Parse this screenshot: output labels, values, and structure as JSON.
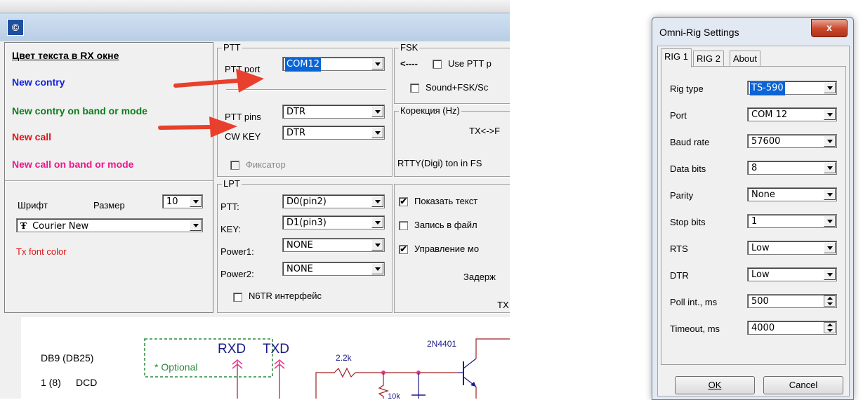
{
  "left_window": {
    "icon_glyph": "©",
    "colors_section": {
      "heading": "Цвет текста в RX окне",
      "items": [
        {
          "label": "New contry",
          "color": "#1020e0"
        },
        {
          "label": "New contry on band or mode",
          "color": "#0a7d1a"
        },
        {
          "label": "New call",
          "color": "#e01414"
        },
        {
          "label": "New call on band or mode",
          "color": "#f0148c"
        }
      ],
      "font_label": "Шрифт",
      "size_label": "Размер",
      "size_value": "10",
      "font_value": "Courier New",
      "tx_font_color": "Tx font color",
      "tx_font_color_hex": "#e01414"
    },
    "ptt": {
      "title": "PTT",
      "port_label": "PTT port",
      "port_value": "COM12",
      "pins_label": "PTT pins",
      "pins_value": "DTR",
      "cwkey_label": "CW KEY",
      "cwkey_value": "DTR",
      "latch_label": "Фиксатор"
    },
    "fsk": {
      "title": "FSK",
      "arrow": "<----",
      "use_ptt_label": "Use PTT p",
      "sound_fsk_label": "Sound+FSK/Sc"
    },
    "correction": {
      "title": "Корекция (Hz)",
      "txrx": "TX<->F",
      "rtty": "RTTY(Digi) ton in FS"
    },
    "lpt": {
      "title": "LPT",
      "rows": [
        {
          "label": "PTT:",
          "value": "D0(pin2)"
        },
        {
          "label": "KEY:",
          "value": "D1(pin3)"
        },
        {
          "label": "Power1:",
          "value": "NONE"
        },
        {
          "label": "Power2:",
          "value": "NONE"
        }
      ],
      "n6tr_label": "N6TR интерфейс"
    },
    "options": {
      "show_text": "Показать текст",
      "write_file": "Запись в файл",
      "control": "Управление мо",
      "delay": "Задерж",
      "tx": "TX"
    },
    "schematic": {
      "db9": "DB9 (DB25)",
      "optional": "* Optional",
      "rxd": "RXD",
      "txd": "TXD",
      "resistor": "2.2k",
      "transistor": "2N4401",
      "pin_num": "1 (8)",
      "pin_name": "DCD",
      "resistor2": "10k"
    },
    "arrow_color": "#e8402c"
  },
  "omni_rig": {
    "title": "Omni-Rig Settings",
    "close_glyph": "x",
    "tabs": [
      "RIG 1",
      "RIG 2",
      "About"
    ],
    "rows": [
      {
        "label": "Rig type",
        "value": "TS-590",
        "selected": true,
        "ctrl": "combo"
      },
      {
        "label": "Port",
        "value": "COM 12",
        "ctrl": "combo"
      },
      {
        "label": "Baud rate",
        "value": "57600",
        "ctrl": "combo"
      },
      {
        "label": "Data bits",
        "value": "8",
        "ctrl": "combo"
      },
      {
        "label": "Parity",
        "value": "None",
        "ctrl": "combo"
      },
      {
        "label": "Stop bits",
        "value": "1",
        "ctrl": "combo"
      },
      {
        "label": "RTS",
        "value": "Low",
        "ctrl": "combo"
      },
      {
        "label": "DTR",
        "value": "Low",
        "ctrl": "combo"
      },
      {
        "label": "Poll int., ms",
        "value": "500",
        "ctrl": "spin"
      },
      {
        "label": "Timeout, ms",
        "value": "4000",
        "ctrl": "spin"
      }
    ],
    "ok": "OK",
    "cancel": "Cancel"
  }
}
